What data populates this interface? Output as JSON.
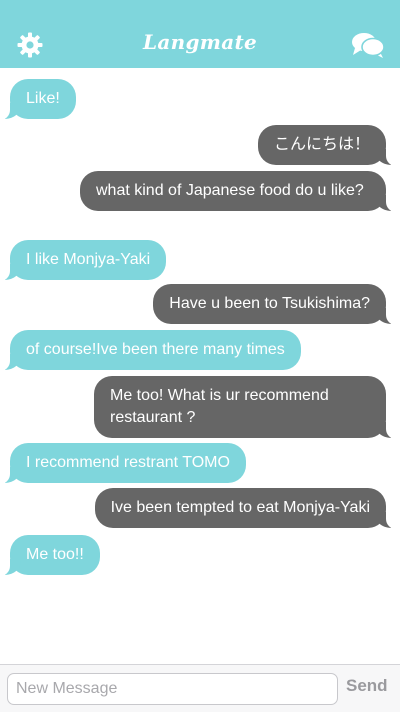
{
  "header": {
    "title": "Langmate",
    "left_icon": "gear-icon",
    "right_icon": "chat-bubbles-icon",
    "background_color": "#7fd6dc"
  },
  "colors": {
    "incoming_bubble": "#7fd6dc",
    "outgoing_bubble": "#666666",
    "bubble_text": "#ffffff"
  },
  "messages": [
    {
      "direction": "in",
      "text": "Like!"
    },
    {
      "direction": "out",
      "text": "こんにちは！"
    },
    {
      "direction": "out",
      "text": "what kind of Japanese food do u like?"
    },
    {
      "direction": "in",
      "text": "I like Monjya-Yaki"
    },
    {
      "direction": "out",
      "text": "Have u been to Tsukishima?"
    },
    {
      "direction": "in",
      "text": "of course!Ive been there many times"
    },
    {
      "direction": "out",
      "text": "Me too! What is ur recommend restaurant ?"
    },
    {
      "direction": "in",
      "text": "I recommend restrant TOMO"
    },
    {
      "direction": "out",
      "text": "Ive been tempted to eat Monjya-Yaki"
    },
    {
      "direction": "in",
      "text": "Me too!!"
    }
  ],
  "composer": {
    "placeholder": "New Message",
    "value": "",
    "send_label": "Send"
  }
}
